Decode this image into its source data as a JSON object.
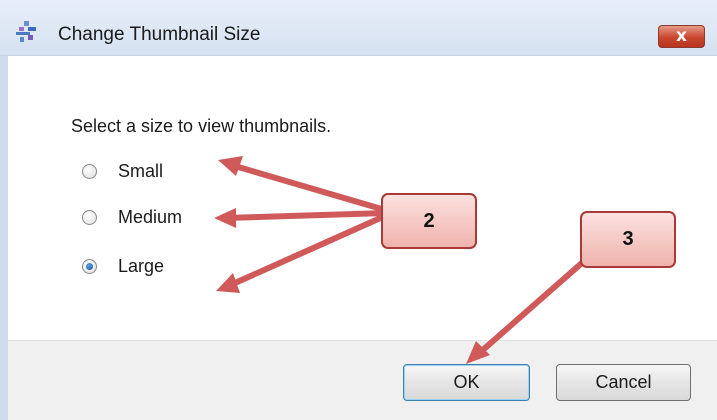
{
  "dialog": {
    "title": "Change Thumbnail Size",
    "close_label": "x",
    "prompt": "Select a size to view thumbnails.",
    "options": [
      {
        "label": "Small",
        "selected": false
      },
      {
        "label": "Medium",
        "selected": false
      },
      {
        "label": "Large",
        "selected": true
      }
    ],
    "buttons": {
      "ok": "OK",
      "cancel": "Cancel"
    }
  },
  "annotations": {
    "callout_2": "2",
    "callout_3": "3",
    "arrow_color": "#d05a5a"
  }
}
